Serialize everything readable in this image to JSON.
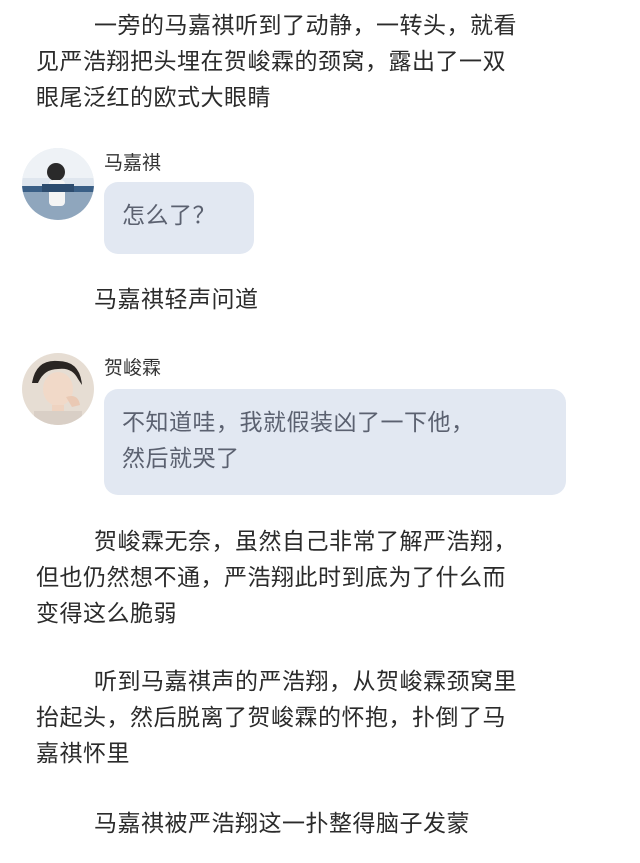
{
  "paragraphs": [
    {
      "lines": [
        "一旁的马嘉祺听到了动静，一转头，就看",
        "见严浩翔把头埋在贺峻霖的颈窝，露出了一双",
        "眼尾泛红的欧式大眼睛"
      ]
    },
    {
      "lines": [
        "马嘉祺轻声问道"
      ]
    },
    {
      "lines": [
        "贺峻霖无奈，虽然自己非常了解严浩翔，",
        "但也仍然想不通，严浩翔此时到底为了什么而",
        "变得这么脆弱"
      ]
    },
    {
      "lines": [
        "听到马嘉祺声的严浩翔，从贺峻霖颈窝里",
        "抬起头，然后脱离了贺峻霖的怀抱，扑倒了马",
        "嘉祺怀里"
      ]
    },
    {
      "lines": [
        "马嘉祺被严浩翔这一扑整得脑子发蒙"
      ]
    }
  ],
  "messages": [
    {
      "sender": "马嘉祺",
      "lines": [
        "怎么了？"
      ],
      "avatar_icon": "avatar-photo-icon"
    },
    {
      "sender": "贺峻霖",
      "lines": [
        "不知道哇，我就假装凶了一下他，",
        "然后就哭了"
      ],
      "avatar_icon": "avatar-photo-icon"
    }
  ],
  "colors": {
    "bubble_bg": "#e2e8f2",
    "bubble_text": "#5b6170",
    "body_text": "#2b2b2b"
  }
}
